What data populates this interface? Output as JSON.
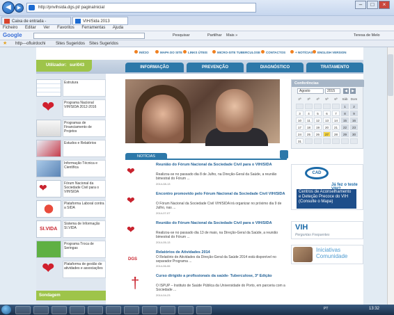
{
  "browser": {
    "address": "http://pnvihsida.dgs.pt/ paginaInicial",
    "tabs": [
      {
        "label": "Caixa de entrada - teresa.melo..."
      },
      {
        "label": "VIH/Sida 2013"
      }
    ],
    "menu": [
      "Ficheiro",
      "Editar",
      "Ver",
      "Favoritos",
      "Ferramentas",
      "Ajuda"
    ],
    "google": {
      "label": "Google",
      "pesquisar": "Pesquisar",
      "partilhar": "Partilhar",
      "mais": "Mais »",
      "user": "Teresa de Melo"
    },
    "favorites": [
      "http---ofluirdochi",
      "Sites Sugeridos",
      "Sites Sugeridos"
    ]
  },
  "site": {
    "toplinks": [
      "INÍCIO",
      "MAPA DO SITE",
      "LINKS ÚTEIS",
      "MICRO-SITE TUBERCULOSE",
      "CONTACTOS",
      "+ NOTÍCIAS",
      "ENGLISH VERSION"
    ],
    "user_label": "Utilizador:",
    "user_name": "suri043",
    "nav": [
      "INFORMAÇÃO",
      "PREVENÇÃO",
      "DIAGNÓSTICO",
      "TRATAMENTO"
    ],
    "left_items": [
      "Estrutura",
      "Programa Nacional VIH/SIDA 2012-2016",
      "Programas de Financiamento de Projetos",
      "Estudos e Relatórios",
      "Informação Técnica e Científica",
      "Fórum Nacional da Sociedade Civil para o VIH/SIDA",
      "Plataforma Laboral contra a SIDA",
      "Sistema de Informação SI.VIDA",
      "Programa Troca de Seringas",
      "Plataforma de gestão de atividades e associações"
    ],
    "sondagem": "Sondagem",
    "noticias_tab": "NOTÍCIAS",
    "news": [
      {
        "title": "Reunião do Fórum Nacional da Sociedade Civil para o VIH/SIDA",
        "body": "Realizou-se no passado dia 8 de Julho, na Direção-Geral da Saúde, a reunião bimestral do Fórum ...",
        "date": "2014-08-13"
      },
      {
        "title": "Encontro promovido pelo Fórum Nacional da Sociedade Civil VIH/SIDA",
        "body": "O Fórum Nacional da Sociedade Civil VIH/SIDA irá organizar no próximo dia 9 de Julho, nas ...",
        "date": "2014-07-07"
      },
      {
        "title": "Reunião do Fórum Nacional da Sociedade Civil para o VIH/SIDA",
        "body": "Realizou-se no passado dia 13 de maio, na Direção-Geral da Saúde, a reunião bimestral do Fórum ...",
        "date": "2014-05-13"
      },
      {
        "title": "Relatórios de Atividades 2014",
        "body": "O Relatório de Atividades da Direção-Geral da Saúde 2014 está disponível no separador Programa ...",
        "date": "2014-06-06"
      },
      {
        "title": "Curso dirigido a profissionais da saúde- Tuberculose, 3ª Edição",
        "body": "O ISPUP – Instituto de Saúde Pública da Universidade do Porto, em parceria com a Sociedade ...",
        "date": "2014-04-23"
      }
    ],
    "calendar": {
      "title": "Conferências",
      "month": "Agosto",
      "year": "2015",
      "days": [
        "2ª",
        "3ª",
        "4ª",
        "5ª",
        "6ª",
        "Sáb",
        "Dom"
      ],
      "weeks": [
        [
          "",
          "",
          "",
          "",
          "",
          "1",
          "2"
        ],
        [
          "3",
          "4",
          "5",
          "6",
          "7",
          "8",
          "9"
        ],
        [
          "10",
          "11",
          "12",
          "13",
          "14",
          "15",
          "16"
        ],
        [
          "17",
          "18",
          "19",
          "20",
          "21",
          "22",
          "23"
        ],
        [
          "24",
          "25",
          "26",
          "27",
          "28",
          "29",
          "30"
        ],
        [
          "31",
          "",
          "",
          "",
          "",
          "",
          ""
        ]
      ]
    },
    "cad": {
      "logo": "CAD",
      "question": "Já fez o teste VIH?",
      "blue": "Centros de Aconselhamento e Deteção Precoce do VIH (Consulte o Mapa)"
    },
    "vih": {
      "big": "VIH",
      "sub": "Perguntas Frequentes"
    },
    "iniciativas": "Iniciativas Comunidade"
  },
  "taskbar": {
    "lang": "PT",
    "clock": "13:32"
  }
}
